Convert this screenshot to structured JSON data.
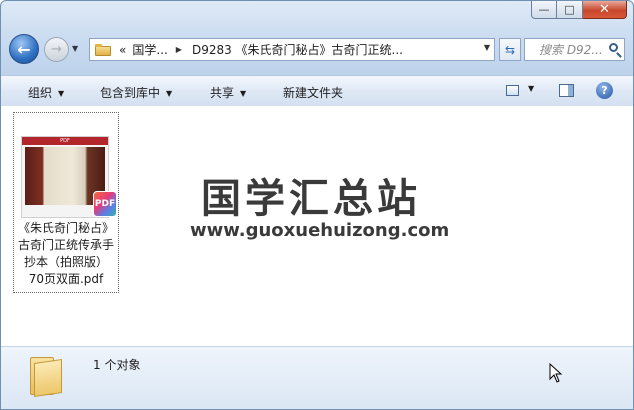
{
  "window": {
    "caption": {
      "minimize": "—",
      "maximize": "□",
      "close": "✕"
    }
  },
  "nav": {
    "back_glyph": "←",
    "forward_glyph": "→",
    "breadcrumb_prefix": "«",
    "crumbs": [
      "国学...",
      "D9283 《朱氏奇门秘占》古奇门正统..."
    ],
    "search_placeholder": "搜索 D92..."
  },
  "toolbar": {
    "organize": "组织",
    "include_library": "包含到库中",
    "share": "共享",
    "new_folder": "新建文件夹",
    "help": "?"
  },
  "content": {
    "file": {
      "thumb_band": "PDF",
      "badge": "PDF",
      "name_lines": [
        "《朱氏奇门秘占》",
        "古奇门正统传承手",
        "抄本（拍照版）",
        "70页双面.pdf"
      ]
    },
    "watermark": {
      "title": "国学汇总站",
      "url": "www.guoxuehuizong.com"
    }
  },
  "details": {
    "status": "1 个对象"
  }
}
